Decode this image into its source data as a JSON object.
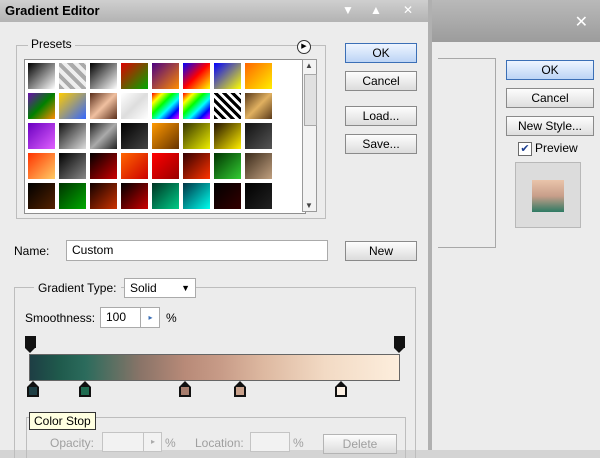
{
  "window": {
    "title": "Gradient Editor",
    "buttons": [
      "▼",
      "▲",
      "✕"
    ]
  },
  "background_dialog": {
    "close_glyph": "✕",
    "ok": "OK",
    "cancel": "Cancel",
    "new_style": "New Style...",
    "preview_checked": true,
    "preview_label": "Preview",
    "preview_swatch_colors": [
      "#e9c4aa",
      "#c89e8a",
      "#2e7a63"
    ]
  },
  "presets": {
    "label": "Presets",
    "swatches": [
      [
        "linear-gradient(135deg,#000,#fff)",
        "repeating-linear-gradient(45deg,#aaa 0 4px,#eee 4px 8px)",
        "linear-gradient(135deg,#000,#fff)",
        "linear-gradient(135deg,#d00,#0a0)",
        "linear-gradient(135deg,#4b0082,#ff8c00)",
        "linear-gradient(135deg,#00f,#f00,#ff0)",
        "linear-gradient(135deg,#00f,#ff0)",
        "linear-gradient(135deg,#ff6600,#ffee00)"
      ],
      [
        "linear-gradient(135deg,#6a0dad,#008000,#ff8c00)",
        "linear-gradient(135deg,#ffcc00,#3366ff)",
        "linear-gradient(135deg,#5a2e1a,#f0c0a0,#5a2e1a)",
        "linear-gradient(135deg,#fff,#ddd,#fff)",
        "linear-gradient(135deg,#f00,#ff0,#0f0,#0ff,#00f,#f0f)",
        "linear-gradient(135deg,#f00,#ff0,#0f0,#0ff,#00f,#f0f)",
        "repeating-linear-gradient(45deg,#000 0 3px,#fff 3px 6px)",
        "linear-gradient(135deg,#5a3a1a,#e0b060,#5a3a1a)"
      ],
      [
        "linear-gradient(135deg,#6a00c0,#e060ff)",
        "linear-gradient(135deg,#111,#ddd)",
        "linear-gradient(135deg,#222,#aaa,#222)",
        "linear-gradient(135deg,#000,#444)",
        "linear-gradient(135deg,#ff9900,#663300)",
        "linear-gradient(135deg,#333300,#eeee00)",
        "linear-gradient(135deg,#221100,#ffee00)",
        "linear-gradient(135deg,#111,#555)"
      ],
      [
        "linear-gradient(135deg,#ff3300,#ffcc66)",
        "linear-gradient(135deg,#000,#888)",
        "linear-gradient(135deg,#000,#cc0000)",
        "linear-gradient(135deg,#ff6600,#cc0000)",
        "linear-gradient(135deg,#ff0000,#990000)",
        "linear-gradient(135deg,#330000,#ff3300)",
        "linear-gradient(135deg,#003300,#33cc33)",
        "linear-gradient(135deg,#3a2a1a,#c0a080)"
      ],
      [
        "linear-gradient(135deg,#000,#552200)",
        "linear-gradient(135deg,#003300,#00aa00)",
        "linear-gradient(135deg,#110000,#cc3300)",
        "linear-gradient(135deg,#000,#cc0000)",
        "linear-gradient(135deg,#003322,#00cc88)",
        "linear-gradient(135deg,#003344,#00ffee)",
        "linear-gradient(135deg,#000,#330000)",
        "linear-gradient(135deg,#000,#222)"
      ]
    ]
  },
  "buttons": {
    "ok": "OK",
    "cancel": "Cancel",
    "load": "Load...",
    "save": "Save...",
    "new": "New"
  },
  "name": {
    "label": "Name:",
    "value": "Custom"
  },
  "gradient_type": {
    "label": "Gradient Type:",
    "selected": "Solid",
    "arrow": "▼"
  },
  "smoothness": {
    "label": "Smoothness:",
    "value": "100",
    "unit": "%",
    "arrow": "▸"
  },
  "gradient": {
    "color_stops": [
      {
        "location_pct": 1,
        "color": "#1e3e44"
      },
      {
        "location_pct": 15,
        "color": "#1f6b50"
      },
      {
        "location_pct": 42,
        "color": "#a67c6c"
      },
      {
        "location_pct": 57,
        "color": "#c8a08a"
      },
      {
        "location_pct": 84,
        "color": "#fdf1e4"
      }
    ],
    "opacity_stops_pct": [
      0,
      100
    ]
  },
  "tooltip": "Color Stop",
  "stops": {
    "opacity_label": "Opacity:",
    "opacity_unit": "%",
    "location_label": "Location:",
    "location_unit": "%",
    "delete": "Delete"
  }
}
